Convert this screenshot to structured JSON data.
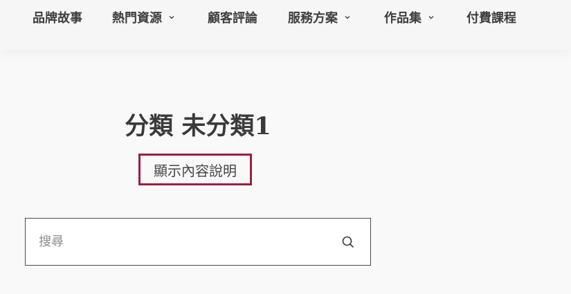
{
  "nav": {
    "items": [
      {
        "label": "品牌故事",
        "has_dropdown": false
      },
      {
        "label": "熱門資源",
        "has_dropdown": true
      },
      {
        "label": "顧客評論",
        "has_dropdown": false
      },
      {
        "label": "服務方案",
        "has_dropdown": true
      },
      {
        "label": "作品集",
        "has_dropdown": true
      },
      {
        "label": "付費課程",
        "has_dropdown": false
      }
    ],
    "dropdown_icon": "chevron-down-icon"
  },
  "category": {
    "title": "分類 未分類1",
    "description": "顯示內容說明"
  },
  "search": {
    "placeholder": "搜尋",
    "value": "",
    "icon": "search-icon"
  },
  "colors": {
    "page_background": "#f9f9f9",
    "header_background": "#f6f6f6",
    "text": "#3a3a3a",
    "highlight_border": "#9a1f3f",
    "search_border": "#4a4a4a"
  }
}
